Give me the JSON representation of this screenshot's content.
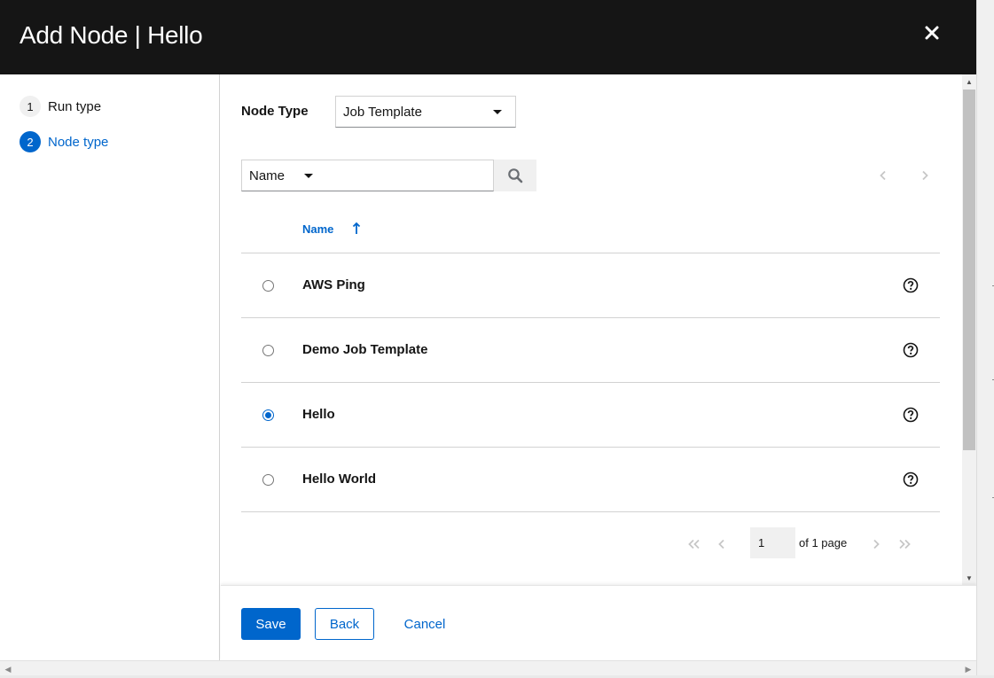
{
  "modal": {
    "title": "Add Node | Hello"
  },
  "wizard_nav": {
    "steps": [
      {
        "number": "1",
        "label": "Run type",
        "current": false
      },
      {
        "number": "2",
        "label": "Node type",
        "current": true
      }
    ]
  },
  "node_type": {
    "label": "Node Type",
    "selected": "Job Template"
  },
  "search": {
    "field_selected": "Name",
    "value": "",
    "placeholder": ""
  },
  "table": {
    "column_header": "Name",
    "sort": "ascending",
    "rows": [
      {
        "name": "AWS Ping",
        "selected": false
      },
      {
        "name": "Demo Job Template",
        "selected": false
      },
      {
        "name": "Hello",
        "selected": true
      },
      {
        "name": "Hello World",
        "selected": false
      }
    ]
  },
  "pagination": {
    "current_page": "1",
    "of_pages_text": "of 1 page"
  },
  "footer": {
    "save_label": "Save",
    "back_label": "Back",
    "cancel_label": "Cancel"
  },
  "icons": {
    "close": "close-icon",
    "search": "search-icon",
    "sort": "sort-ascending-icon",
    "help": "question-circle-icon",
    "pager": [
      "angle-double-left-icon",
      "angle-left-icon",
      "angle-right-icon",
      "angle-double-right-icon"
    ]
  },
  "colors": {
    "header_bg": "#151515",
    "accent": "#0066cc",
    "text": "#151515",
    "border": "#d2d2d2",
    "disabled": "#c7c7c7"
  }
}
